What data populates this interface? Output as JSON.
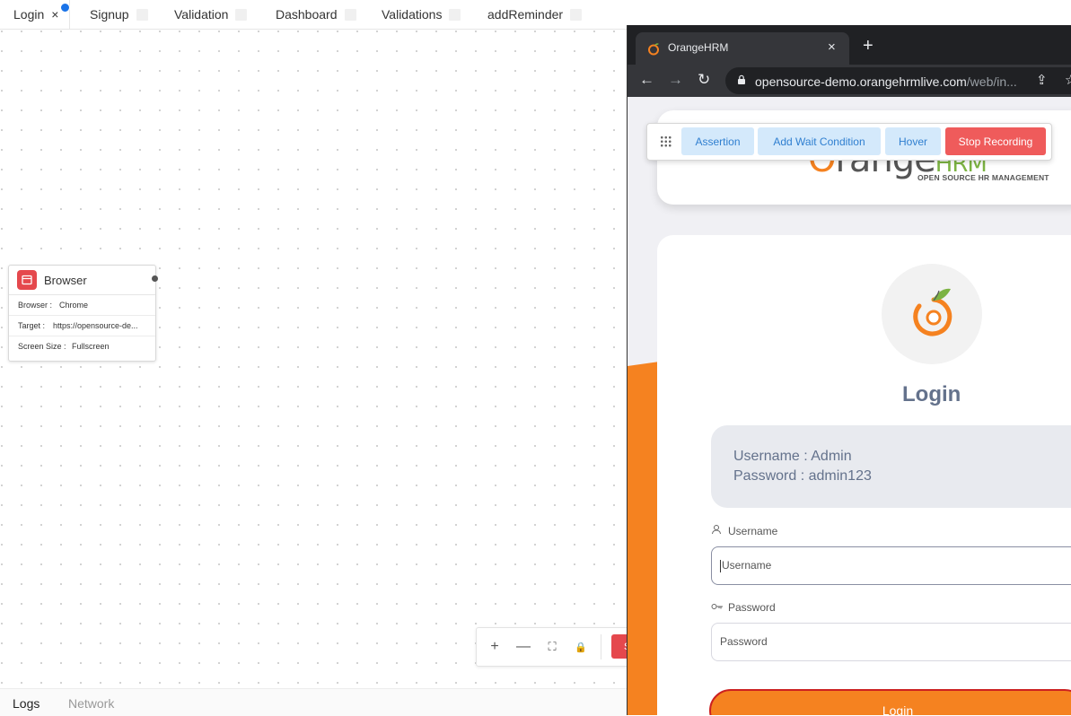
{
  "tabs": [
    {
      "label": "Login",
      "active": true,
      "close": "×"
    },
    {
      "label": "Signup"
    },
    {
      "label": "Validation"
    },
    {
      "label": "Dashboard"
    },
    {
      "label": "Validations"
    },
    {
      "label": "addReminder"
    }
  ],
  "node": {
    "title": "Browser",
    "icon": "browser-window-icon",
    "rows": [
      {
        "key": "Browser :",
        "value": "Chrome"
      },
      {
        "key": "Target :",
        "value": "https://opensource-de..."
      },
      {
        "key": "Screen Size :",
        "value": "Fullscreen"
      }
    ]
  },
  "controls": {
    "zoom_in": "+",
    "zoom_out": "—",
    "fit": "⛶",
    "lock": "🔒",
    "red_label": "S"
  },
  "bottom_tabs": [
    "Logs",
    "Network"
  ],
  "browser": {
    "tab_title": "OrangeHRM",
    "tab_close": "×",
    "new_tab": "+",
    "url_host": "opensource-demo.orangehrmlive.com",
    "url_path": "/web/in...",
    "back": "←",
    "forward": "→",
    "reload": "↻"
  },
  "page": {
    "logo_o": "O",
    "logo_rest": "range",
    "logo_hrm": "HRM",
    "logo_tagline": "OPEN SOURCE HR MANAGEMENT",
    "login_title": "Login",
    "cred_username": "Username : Admin",
    "cred_password": "Password : admin123",
    "username_label": "Username",
    "username_placeholder": "Username",
    "password_label": "Password",
    "password_placeholder": "Password",
    "login_button": "Login"
  },
  "recorder": {
    "buttons": [
      "Assertion",
      "Add Wait Condition",
      "Hover"
    ],
    "stop": "Stop Recording"
  },
  "colors": {
    "accent": "#1a73e8",
    "orange": "#f58220",
    "stop": "#ef5b5b",
    "recorder_btn": "#d4e9fb"
  }
}
